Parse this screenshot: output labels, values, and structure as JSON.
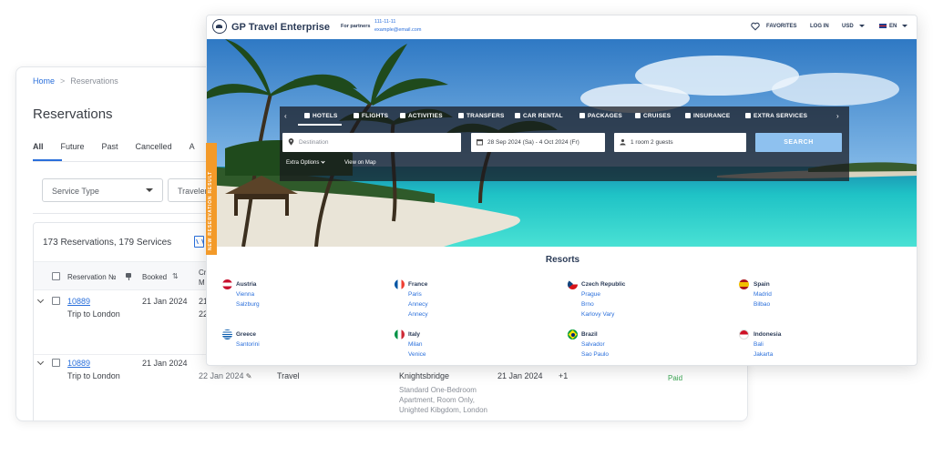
{
  "reservations": {
    "breadcrumb": {
      "home": "Home",
      "separator": ">",
      "current": "Reservations"
    },
    "title": "Reservations",
    "tabs": [
      "All",
      "Future",
      "Past",
      "Cancelled",
      "A"
    ],
    "filters": {
      "service_type": "Service Type",
      "travelers": "Traveler"
    },
    "count_text": "173 Reservations, 179 Services",
    "columns": {
      "reservation_no": "Reservation №",
      "booked": "Booked",
      "created_1": "Cr",
      "created_2": "M"
    },
    "rows": [
      {
        "number": "10889",
        "title": "Trip to London",
        "booked": "21 Jan 2024",
        "created_1": "21",
        "created_2": "22"
      },
      {
        "number": "10889",
        "title": "Trip to London",
        "booked": "21 Jan 2024",
        "created": "22 Jan 2024",
        "service": "Travel",
        "hotel": "Knightsbridge",
        "details_1": "Standard One-Bedroom",
        "details_2": "Apartment, Room Only,",
        "details_3": "Unighted Kibgdom, London",
        "date": "21 Jan 2024",
        "extra": "+1",
        "status": "Paid"
      }
    ]
  },
  "travel": {
    "brand": "GP Travel Enterprise",
    "partners": {
      "label": "For partners",
      "phone": "111-11-11",
      "email": "example@email.com"
    },
    "nav": {
      "favorites": "FAVORITES",
      "login": "LOG IN",
      "currency": "USD",
      "language": "EN"
    },
    "service_tabs": [
      "HOTELS",
      "FLIGHTS",
      "ACTIVITIES",
      "TRANSFERS",
      "CAR RENTAL",
      "PACKAGES",
      "CRUISES",
      "INSURANCE",
      "EXTRA SERVICES"
    ],
    "search": {
      "destination_placeholder": "Destination",
      "dates": "28 Sep 2024 (Sa) - 4 Oct 2024 (Fr)",
      "guests": "1 room 2 guests",
      "button": "SEARCH",
      "extra_options": "Extra Options",
      "view_on_map": "View on Map"
    },
    "side_tab": "NEW RESERVATION RESULT",
    "resorts_title": "Resorts",
    "resorts": [
      {
        "country": "Austria",
        "cities": [
          "Vienna",
          "Salzburg"
        ]
      },
      {
        "country": "France",
        "cities": [
          "Paris",
          "Annecy",
          "Annecy"
        ]
      },
      {
        "country": "Czech Republic",
        "cities": [
          "Prague",
          "Brno",
          "Karlovy Vary"
        ]
      },
      {
        "country": "Spain",
        "cities": [
          "Madrid",
          "Bilbao"
        ]
      },
      {
        "country": "Greece",
        "cities": [
          "Santorini"
        ]
      },
      {
        "country": "Italy",
        "cities": [
          "Milan",
          "Venice"
        ]
      },
      {
        "country": "Brazil",
        "cities": [
          "Salvador",
          "Sao Paulo"
        ]
      },
      {
        "country": "Indonesia",
        "cities": [
          "Bali",
          "Jakarta"
        ]
      }
    ]
  }
}
